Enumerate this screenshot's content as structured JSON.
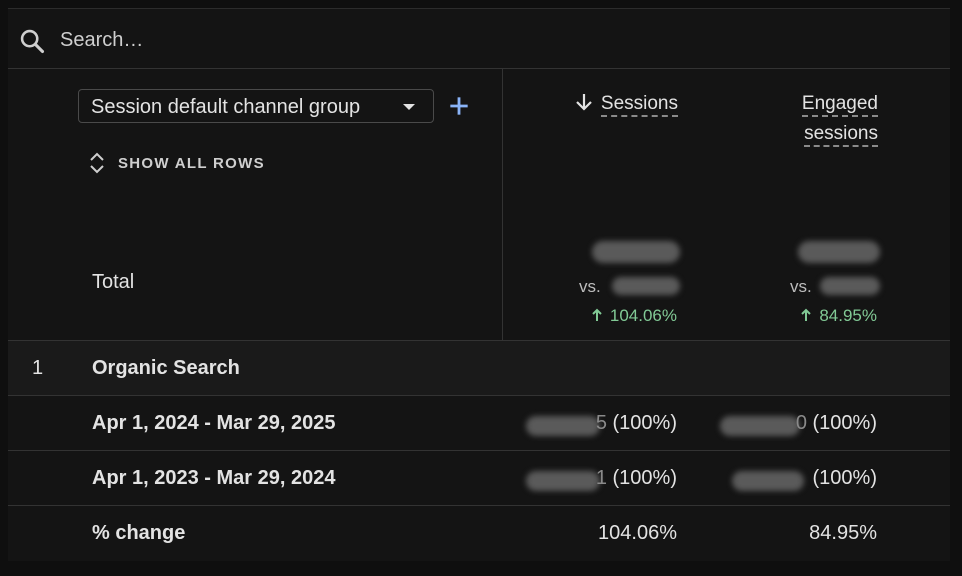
{
  "search": {
    "placeholder": "Search…"
  },
  "dimension": {
    "selected": "Session default channel group",
    "show_rows_label": "SHOW ALL ROWS"
  },
  "columns": {
    "sessions": {
      "label": "Sessions",
      "sorted": "descending"
    },
    "engaged": {
      "label_line1": "Engaged",
      "label_line2": "sessions"
    }
  },
  "total": {
    "label": "Total",
    "sessions": {
      "vs_prefix": "vs.",
      "change": "104.06%"
    },
    "engaged": {
      "vs_prefix": "vs.",
      "change": "84.95%"
    }
  },
  "rows": [
    {
      "num": "1",
      "label": "Organic Search"
    },
    {
      "label": "Apr 1, 2024 - Mar 29, 2025",
      "sessions_pct": "(100%)",
      "sessions_tail": "5",
      "engaged_pct": "(100%)",
      "engaged_tail": "0"
    },
    {
      "label": "Apr 1, 2023 - Mar 29, 2024",
      "sessions_pct": "(100%)",
      "sessions_tail": "1",
      "engaged_pct": "(100%)"
    },
    {
      "label": "% change",
      "sessions": "104.06%",
      "engaged": "84.95%"
    }
  ],
  "colors": {
    "background": "#141414",
    "positive": "#81c995",
    "accent": "#8ab4f8"
  }
}
